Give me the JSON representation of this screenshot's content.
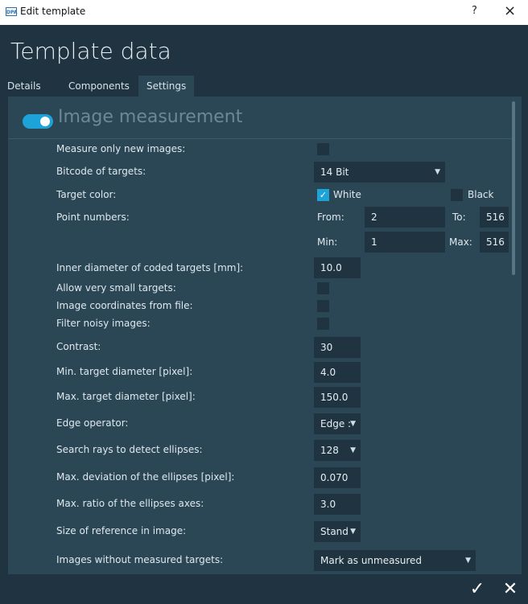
{
  "window": {
    "title": "Edit template",
    "help_label": "?",
    "close_label": "×",
    "logo_text": "DPA"
  },
  "header": {
    "title": "Template data"
  },
  "tabs": [
    {
      "label": "Details"
    },
    {
      "label": "Components"
    },
    {
      "label": "Settings"
    }
  ],
  "section": {
    "title": "Image measurement",
    "enabled": true
  },
  "fields": {
    "measure_only_new": {
      "label": "Measure only new images:",
      "checked": false
    },
    "bitcode": {
      "label": "Bitcode of targets:",
      "value": "14 Bit"
    },
    "target_color": {
      "label": "Target color:",
      "white_label": "White",
      "white_checked": true,
      "black_label": "Black",
      "black_checked": false
    },
    "point_numbers": {
      "label": "Point numbers:",
      "from_label": "From:",
      "from_value": "2",
      "to_label": "To:",
      "to_value": "516",
      "min_label": "Min:",
      "min_value": "1",
      "max_label": "Max:",
      "max_value": "516"
    },
    "inner_diameter": {
      "label": "Inner diameter of coded targets [mm]:",
      "value": "10.0"
    },
    "very_small": {
      "label": "Allow very small targets:",
      "checked": false
    },
    "coords_from_file": {
      "label": "Image coordinates from file:",
      "checked": false
    },
    "filter_noisy": {
      "label": "Filter noisy images:",
      "checked": false
    },
    "contrast": {
      "label": "Contrast:",
      "value": "30"
    },
    "min_diameter": {
      "label": "Min. target diameter [pixel]:",
      "value": "4.0"
    },
    "max_diameter": {
      "label": "Max. target diameter [pixel]:",
      "value": "150.0"
    },
    "edge_operator": {
      "label": "Edge operator:",
      "value": "Edge :"
    },
    "search_rays": {
      "label": "Search rays to detect ellipses:",
      "value": "128"
    },
    "max_deviation": {
      "label": "Max. deviation of the ellipses [pixel]:",
      "value": "0.070"
    },
    "max_ratio": {
      "label": "Max. ratio of the ellipses axes:",
      "value": "3.0"
    },
    "reference_size": {
      "label": "Size of reference in image:",
      "value": "Stand"
    },
    "without_targets": {
      "label": "Images without measured targets:",
      "value": "Mark as unmeasured"
    }
  },
  "footer": {
    "ok_label": "✓",
    "cancel_label": "✕"
  },
  "icons": {
    "chevron": "chevron-down-icon",
    "check": "check-icon"
  },
  "colors": {
    "accent": "#1ea3d8",
    "panel": "#2b4756",
    "background": "#1f3440"
  }
}
